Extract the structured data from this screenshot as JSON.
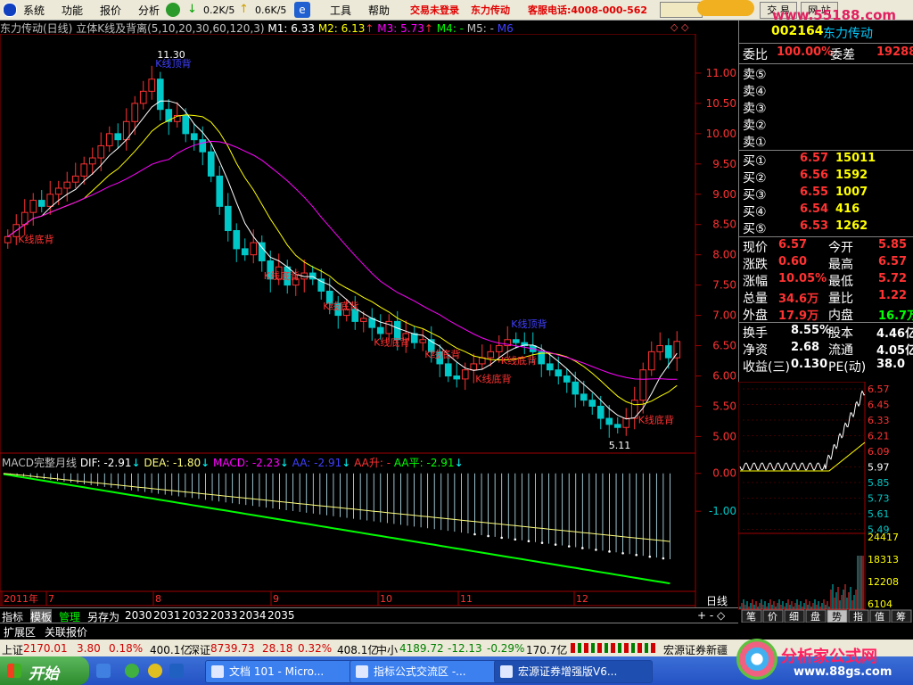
{
  "menubar": {
    "items": [
      "系统",
      "功能",
      "报价",
      "分析"
    ],
    "speed_down": "0.2K/5",
    "speed_up": "0.6K/5",
    "items2": [
      "工具",
      "帮助"
    ],
    "login_status": "交易未登录",
    "stock_link": "东力传动",
    "hotline": "客服电话:4008-000-562",
    "trade_btns": [
      "交 易",
      "网 站"
    ],
    "watermark": "www.55188.com"
  },
  "colors": {
    "up": "#ff3232",
    "down": "#00c8c8",
    "ma5": "#ffffff",
    "ma10": "#ffff00",
    "ma20": "#ff00ff",
    "dif": "#ffffff",
    "dea": "#ffff7f",
    "macd": "#ff00ff",
    "aa": "#0000ff",
    "aaup": "#ff0000",
    "aaflat": "#00ff00",
    "green": "#00ff00"
  },
  "chart_header": {
    "title": "东力传动(日线)",
    "indicator": "立体K线及背离(5,10,20,30,60,120,3)",
    "m1": "M1: 6.33",
    "m2": "M2: 6.13",
    "m3": "M3: 5.73",
    "m4": "M4: -",
    "m5": "M5: -",
    "m6": "M6"
  },
  "macd_header": {
    "name": "MACD完整月线",
    "dif": "DIF: -2.91",
    "dea": "DEA: -1.80",
    "macd": "MACD: -2.23",
    "aa": "AA: -2.91",
    "aaup": "AA升: -",
    "aaflat": "AA平: -2.91"
  },
  "chart_data": [
    {
      "type": "candlestick",
      "title": "东力传动(日线)",
      "y_ticks": [
        11.0,
        10.5,
        10.0,
        9.5,
        9.0,
        8.5,
        8.0,
        7.5,
        7.0,
        6.5,
        6.0,
        5.5,
        5.0
      ],
      "ylim": [
        4.8,
        11.5
      ],
      "x_labels": [
        "2011年",
        "7",
        "8",
        "9",
        "10",
        "11",
        "12"
      ],
      "annotations": [
        {
          "text": "11.30",
          "kind": "high"
        },
        {
          "text": "K线顶背",
          "kind": "top"
        },
        {
          "text": "K线底背",
          "kind": "bottom"
        },
        {
          "text": "K线底背",
          "kind": "bottom"
        },
        {
          "text": "K线底背",
          "kind": "bottom"
        },
        {
          "text": "K线底背",
          "kind": "bottom"
        },
        {
          "text": "K线底背",
          "kind": "bottom"
        },
        {
          "text": "K线底背",
          "kind": "bottom"
        },
        {
          "text": "K线底背",
          "kind": "bottom"
        },
        {
          "text": "K线顶背",
          "kind": "top"
        },
        {
          "text": "5.11",
          "kind": "low"
        },
        {
          "text": "K线底背",
          "kind": "bottom"
        }
      ],
      "closes": [
        8.3,
        8.5,
        8.7,
        8.9,
        8.8,
        9.0,
        9.1,
        9.2,
        9.3,
        9.5,
        9.6,
        9.8,
        10.0,
        9.9,
        10.2,
        10.5,
        10.7,
        10.9,
        10.4,
        10.2,
        10.3,
        10.0,
        9.9,
        9.7,
        9.3,
        8.8,
        8.4,
        8.1,
        8.0,
        8.2,
        7.9,
        7.6,
        7.8,
        7.5,
        7.6,
        7.7,
        7.6,
        7.4,
        7.2,
        7.0,
        7.1,
        6.9,
        6.95,
        6.8,
        6.7,
        6.9,
        6.6,
        6.7,
        6.55,
        6.6,
        6.4,
        6.2,
        6.0,
        5.95,
        6.1,
        6.2,
        6.3,
        6.4,
        6.5,
        6.6,
        6.55,
        6.5,
        6.4,
        6.2,
        6.1,
        6.0,
        5.9,
        5.7,
        5.6,
        5.5,
        5.3,
        5.2,
        5.15,
        5.3,
        5.6,
        6.1,
        6.4,
        6.5,
        6.3,
        6.57
      ],
      "ma_series": [
        {
          "name": "M1",
          "last": "6.33"
        },
        {
          "name": "M2",
          "last": "6.13"
        },
        {
          "name": "M3",
          "last": "5.73"
        }
      ]
    },
    {
      "type": "line",
      "title": "MACD完整月线",
      "y_ticks": [
        0.0,
        -1.0
      ],
      "ylim": [
        -3.0,
        0.3
      ],
      "series": [
        {
          "name": "DIF",
          "start": -0.02,
          "end": -2.91
        },
        {
          "name": "DEA",
          "start": 0.0,
          "end": -1.8
        }
      ]
    },
    {
      "type": "line",
      "title": "intraday",
      "price_ticks": [
        "6.57",
        "6.45",
        "6.33",
        "6.21",
        "6.09",
        "5.97",
        "5.85",
        "5.73",
        "5.61",
        "5.49"
      ],
      "volume_ticks": [
        "24417",
        "18313",
        "12208",
        "6104"
      ]
    }
  ],
  "right_panel": {
    "code": "002164",
    "name": "东力传动",
    "weibi_label": "委比",
    "weibi": "100.00%",
    "weicha_label": "委差",
    "weicha": "19288",
    "sell_labels": [
      "卖⑤",
      "卖④",
      "卖③",
      "卖②",
      "卖①"
    ],
    "buy": [
      {
        "label": "买①",
        "price": "6.57",
        "vol": "15011"
      },
      {
        "label": "买②",
        "price": "6.56",
        "vol": "1592"
      },
      {
        "label": "买③",
        "price": "6.55",
        "vol": "1007"
      },
      {
        "label": "买④",
        "price": "6.54",
        "vol": "416"
      },
      {
        "label": "买⑤",
        "price": "6.53",
        "vol": "1262"
      }
    ],
    "quote": [
      {
        "l1": "现价",
        "v1": "6.57",
        "l2": "今开",
        "v2": "5.85"
      },
      {
        "l1": "涨跌",
        "v1": "0.60",
        "l2": "最高",
        "v2": "6.57"
      },
      {
        "l1": "涨幅",
        "v1": "10.05%",
        "l2": "最低",
        "v2": "5.72"
      },
      {
        "l1": "总量",
        "v1": "34.6万",
        "l2": "量比",
        "v2": "1.22"
      },
      {
        "l1": "外盘",
        "v1": "17.9万",
        "l2": "内盘",
        "v2": "16.7万"
      }
    ],
    "fin": [
      {
        "l1": "换手",
        "v1": "8.55%",
        "l2": "股本",
        "v2": "4.46亿"
      },
      {
        "l1": "净资",
        "v1": "2.68",
        "l2": "流通",
        "v2": "4.05亿"
      },
      {
        "l1": "收益(三)",
        "v1": "0.130",
        "l2": "PE(动)",
        "v2": "38.0"
      }
    ]
  },
  "period_label": "日线",
  "tabs": [
    "指标",
    "模板",
    "管理",
    "另存为",
    "2030",
    "2031",
    "2032",
    "2033",
    "2034",
    "2035"
  ],
  "ext_tabs": [
    "扩展区",
    "关联报价"
  ],
  "side_tabs": [
    "笔",
    "价",
    "细",
    "盘",
    "势",
    "指",
    "值",
    "筹"
  ],
  "index_bar": {
    "sh_label": "上证",
    "sh": "2170.01",
    "sh_chg": "3.80",
    "sh_pct": "0.18%",
    "sh_amt": "400.1亿",
    "sz_label": "深证",
    "sz": "8739.73",
    "sz_chg": "28.18",
    "sz_pct": "0.32%",
    "sz_amt": "408.1亿",
    "zx_label": "中小",
    "zx": "4189.72",
    "zx_chg": "-12.13",
    "zx_pct": "-0.29%",
    "zx_amt": "170.7亿",
    "news": "宏源证券新疆"
  },
  "taskbar": {
    "start": "开始",
    "tasks": [
      "文档 101 - Micro...",
      "指标公式交流区 -...",
      "宏源证券增强版V6..."
    ]
  },
  "site_watermark": {
    "cn": "分析家公式网",
    "url": "www.88gs.com"
  }
}
